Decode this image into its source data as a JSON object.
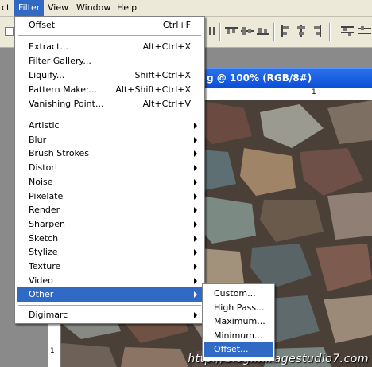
{
  "menubar": {
    "items": [
      {
        "label": "ct"
      },
      {
        "label": "Filter"
      },
      {
        "label": "View"
      },
      {
        "label": "Window"
      },
      {
        "label": "Help"
      }
    ]
  },
  "document": {
    "title": "g @ 100% (RGB/8#)",
    "ruler_top_label": "1",
    "ruler_left_label": "1"
  },
  "filter_menu": {
    "groups": [
      [
        {
          "label": "Offset",
          "shortcut": "Ctrl+F"
        }
      ],
      [
        {
          "label": "Extract...",
          "shortcut": "Alt+Ctrl+X"
        },
        {
          "label": "Filter Gallery...",
          "shortcut": ""
        },
        {
          "label": "Liquify...",
          "shortcut": "Shift+Ctrl+X"
        },
        {
          "label": "Pattern Maker...",
          "shortcut": "Alt+Shift+Ctrl+X"
        },
        {
          "label": "Vanishing Point...",
          "shortcut": "Alt+Ctrl+V"
        }
      ],
      [
        {
          "label": "Artistic"
        },
        {
          "label": "Blur"
        },
        {
          "label": "Brush Strokes"
        },
        {
          "label": "Distort"
        },
        {
          "label": "Noise"
        },
        {
          "label": "Pixelate"
        },
        {
          "label": "Render"
        },
        {
          "label": "Sharpen"
        },
        {
          "label": "Sketch"
        },
        {
          "label": "Stylize"
        },
        {
          "label": "Texture"
        },
        {
          "label": "Video"
        },
        {
          "label": "Other"
        }
      ],
      [
        {
          "label": "Digimarc"
        }
      ]
    ]
  },
  "other_submenu": {
    "items": [
      {
        "label": "Custom..."
      },
      {
        "label": "High Pass..."
      },
      {
        "label": "Maximum..."
      },
      {
        "label": "Minimum..."
      },
      {
        "label": "Offset..."
      }
    ]
  },
  "watermark": "http://blog.miragestudio7.com",
  "colors": {
    "menu_highlight": "#316ac5",
    "titlebar": "#0a4fd4"
  }
}
